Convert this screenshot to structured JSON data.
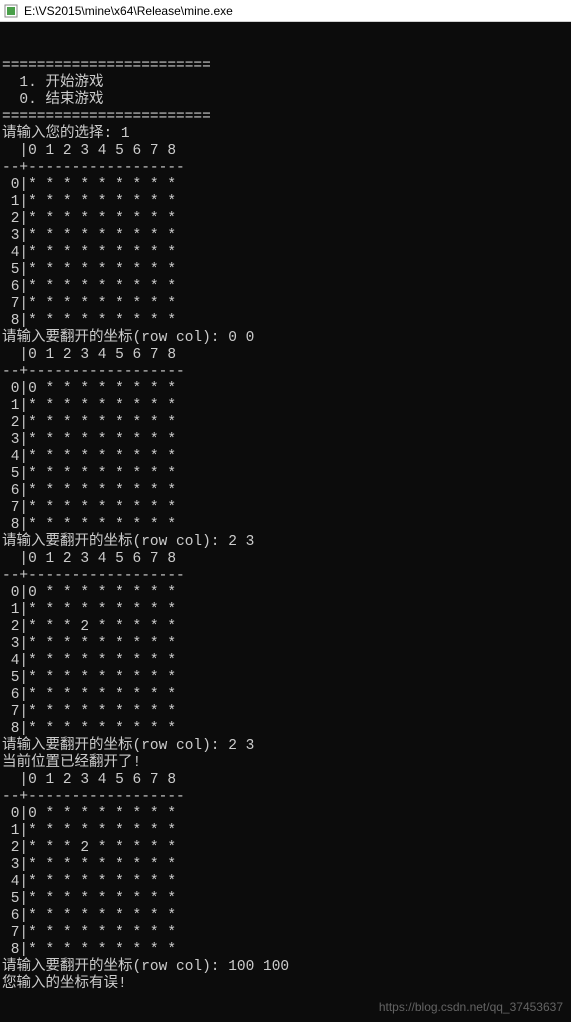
{
  "window": {
    "title": "E:\\VS2015\\mine\\x64\\Release\\mine.exe"
  },
  "lines": [
    "========================",
    "  1. 开始游戏",
    "  0. 结束游戏",
    "========================",
    "请输入您的选择: 1",
    "  |0 1 2 3 4 5 6 7 8",
    "--+------------------",
    " 0|* * * * * * * * *",
    " 1|* * * * * * * * *",
    " 2|* * * * * * * * *",
    " 3|* * * * * * * * *",
    " 4|* * * * * * * * *",
    " 5|* * * * * * * * *",
    " 6|* * * * * * * * *",
    " 7|* * * * * * * * *",
    " 8|* * * * * * * * *",
    "请输入要翻开的坐标(row col): 0 0",
    "  |0 1 2 3 4 5 6 7 8",
    "--+------------------",
    " 0|0 * * * * * * * *",
    " 1|* * * * * * * * *",
    " 2|* * * * * * * * *",
    " 3|* * * * * * * * *",
    " 4|* * * * * * * * *",
    " 5|* * * * * * * * *",
    " 6|* * * * * * * * *",
    " 7|* * * * * * * * *",
    " 8|* * * * * * * * *",
    "请输入要翻开的坐标(row col): 2 3",
    "  |0 1 2 3 4 5 6 7 8",
    "--+------------------",
    " 0|0 * * * * * * * *",
    " 1|* * * * * * * * *",
    " 2|* * * 2 * * * * *",
    " 3|* * * * * * * * *",
    " 4|* * * * * * * * *",
    " 5|* * * * * * * * *",
    " 6|* * * * * * * * *",
    " 7|* * * * * * * * *",
    " 8|* * * * * * * * *",
    "请输入要翻开的坐标(row col): 2 3",
    "当前位置已经翻开了!",
    "  |0 1 2 3 4 5 6 7 8",
    "--+------------------",
    " 0|0 * * * * * * * *",
    " 1|* * * * * * * * *",
    " 2|* * * 2 * * * * *",
    " 3|* * * * * * * * *",
    " 4|* * * * * * * * *",
    " 5|* * * * * * * * *",
    " 6|* * * * * * * * *",
    " 7|* * * * * * * * *",
    " 8|* * * * * * * * *",
    "请输入要翻开的坐标(row col): 100 100",
    "您输入的坐标有误!"
  ],
  "watermark": "https://blog.csdn.net/qq_37453637"
}
